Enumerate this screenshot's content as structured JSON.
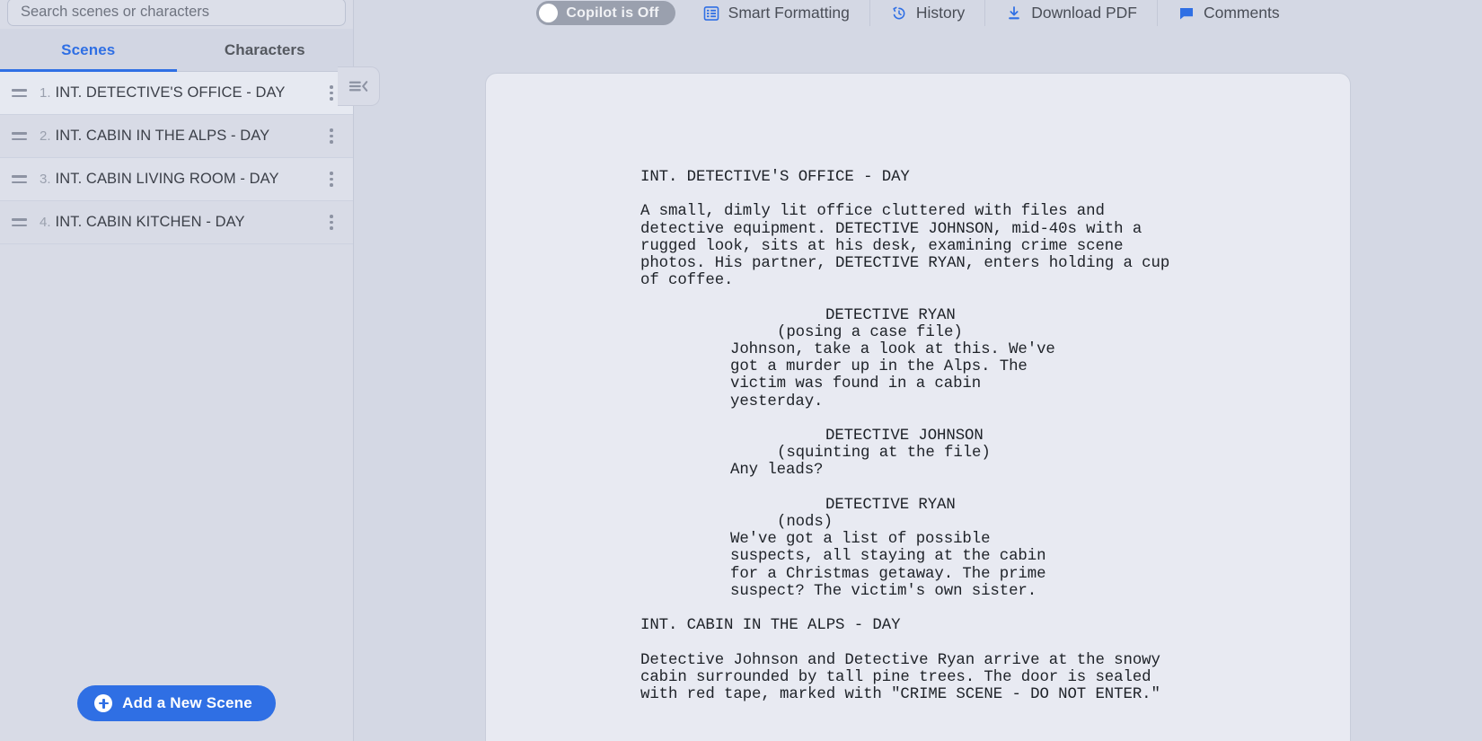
{
  "sidebar": {
    "search": {
      "placeholder": "Search scenes or characters",
      "value": ""
    },
    "tabs": [
      {
        "label": "Scenes",
        "active": true
      },
      {
        "label": "Characters",
        "active": false
      }
    ],
    "scenes": [
      {
        "number": "1.",
        "title": "INT. DETECTIVE'S OFFICE - DAY"
      },
      {
        "number": "2.",
        "title": "INT. CABIN IN THE ALPS - DAY"
      },
      {
        "number": "3.",
        "title": "INT. CABIN LIVING ROOM - DAY"
      },
      {
        "number": "4.",
        "title": "INT. CABIN KITCHEN - DAY"
      }
    ],
    "add_scene_label": "Add a New Scene"
  },
  "toolbar": {
    "copilot_label": "Copilot is Off",
    "smart_formatting_label": "Smart Formatting",
    "history_label": "History",
    "download_pdf_label": "Download PDF",
    "comments_label": "Comments"
  },
  "colors": {
    "accent": "#2f6fe4",
    "app_background": "#d4d8e4",
    "page_background": "#e8eaf2",
    "sidebar_background": "#d8dbe6",
    "toggle_off": "#9aa0ae",
    "text": "#3c4049"
  },
  "script": {
    "lines": [
      {
        "type": "heading",
        "text": "INT. DETECTIVE'S OFFICE - DAY"
      },
      {
        "type": "blank",
        "text": ""
      },
      {
        "type": "action",
        "text": "A small, dimly lit office cluttered with files and"
      },
      {
        "type": "action",
        "text": "detective equipment. DETECTIVE JOHNSON, mid-40s with a"
      },
      {
        "type": "action",
        "text": "rugged look, sits at his desk, examining crime scene"
      },
      {
        "type": "action",
        "text": "photos. His partner, DETECTIVE RYAN, enters holding a cup"
      },
      {
        "type": "action",
        "text": "of coffee."
      },
      {
        "type": "blank",
        "text": ""
      },
      {
        "type": "character",
        "text": "DETECTIVE RYAN"
      },
      {
        "type": "parenthetical",
        "text": "(posing a case file)"
      },
      {
        "type": "dialogue",
        "text": "Johnson, take a look at this. We've"
      },
      {
        "type": "dialogue",
        "text": "got a murder up in the Alps. The"
      },
      {
        "type": "dialogue",
        "text": "victim was found in a cabin"
      },
      {
        "type": "dialogue",
        "text": "yesterday."
      },
      {
        "type": "blank",
        "text": ""
      },
      {
        "type": "character",
        "text": "DETECTIVE JOHNSON"
      },
      {
        "type": "parenthetical",
        "text": "(squinting at the file)"
      },
      {
        "type": "dialogue",
        "text": "Any leads?"
      },
      {
        "type": "blank",
        "text": ""
      },
      {
        "type": "character",
        "text": "DETECTIVE RYAN"
      },
      {
        "type": "parenthetical",
        "text": "(nods)"
      },
      {
        "type": "dialogue",
        "text": "We've got a list of possible"
      },
      {
        "type": "dialogue",
        "text": "suspects, all staying at the cabin"
      },
      {
        "type": "dialogue",
        "text": "for a Christmas getaway. The prime"
      },
      {
        "type": "dialogue",
        "text": "suspect? The victim's own sister."
      },
      {
        "type": "blank",
        "text": ""
      },
      {
        "type": "heading",
        "text": "INT. CABIN IN THE ALPS - DAY"
      },
      {
        "type": "blank",
        "text": ""
      },
      {
        "type": "action",
        "text": "Detective Johnson and Detective Ryan arrive at the snowy"
      },
      {
        "type": "action",
        "text": "cabin surrounded by tall pine trees. The door is sealed"
      },
      {
        "type": "action",
        "text": "with red tape, marked with \"CRIME SCENE - DO NOT ENTER.\""
      }
    ]
  }
}
